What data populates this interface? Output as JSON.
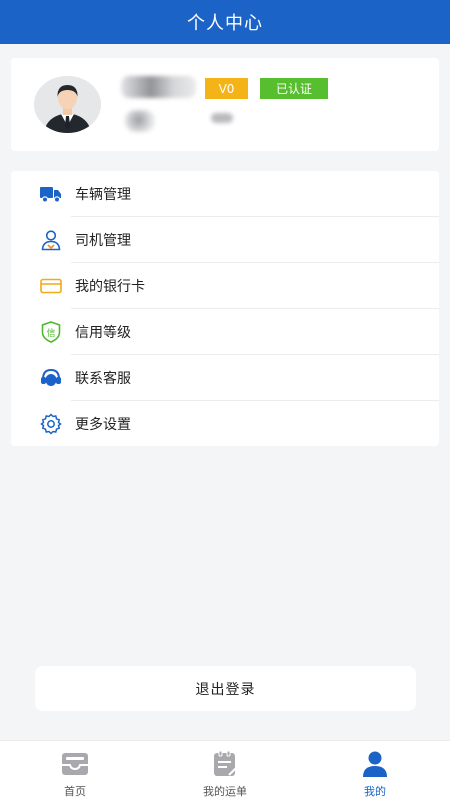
{
  "header": {
    "title": "个人中心"
  },
  "profile": {
    "level_badge": "V0",
    "verified_badge": "已认证"
  },
  "menu": [
    {
      "label": "车辆管理",
      "icon": "truck-icon"
    },
    {
      "label": "司机管理",
      "icon": "driver-icon"
    },
    {
      "label": "我的银行卡",
      "icon": "bank-card-icon"
    },
    {
      "label": "信用等级",
      "icon": "credit-shield-icon"
    },
    {
      "label": "联系客服",
      "icon": "headset-icon"
    },
    {
      "label": "更多设置",
      "icon": "gear-icon"
    }
  ],
  "logout": {
    "label": "退出登录"
  },
  "tabbar": [
    {
      "label": "首页",
      "icon": "inbox-icon",
      "active": false
    },
    {
      "label": "我的运单",
      "icon": "waybill-icon",
      "active": false
    },
    {
      "label": "我的",
      "icon": "user-icon",
      "active": true
    }
  ],
  "colors": {
    "primary": "#1b63c6",
    "badge_level": "#f4b417",
    "badge_verified": "#57bf2f"
  }
}
